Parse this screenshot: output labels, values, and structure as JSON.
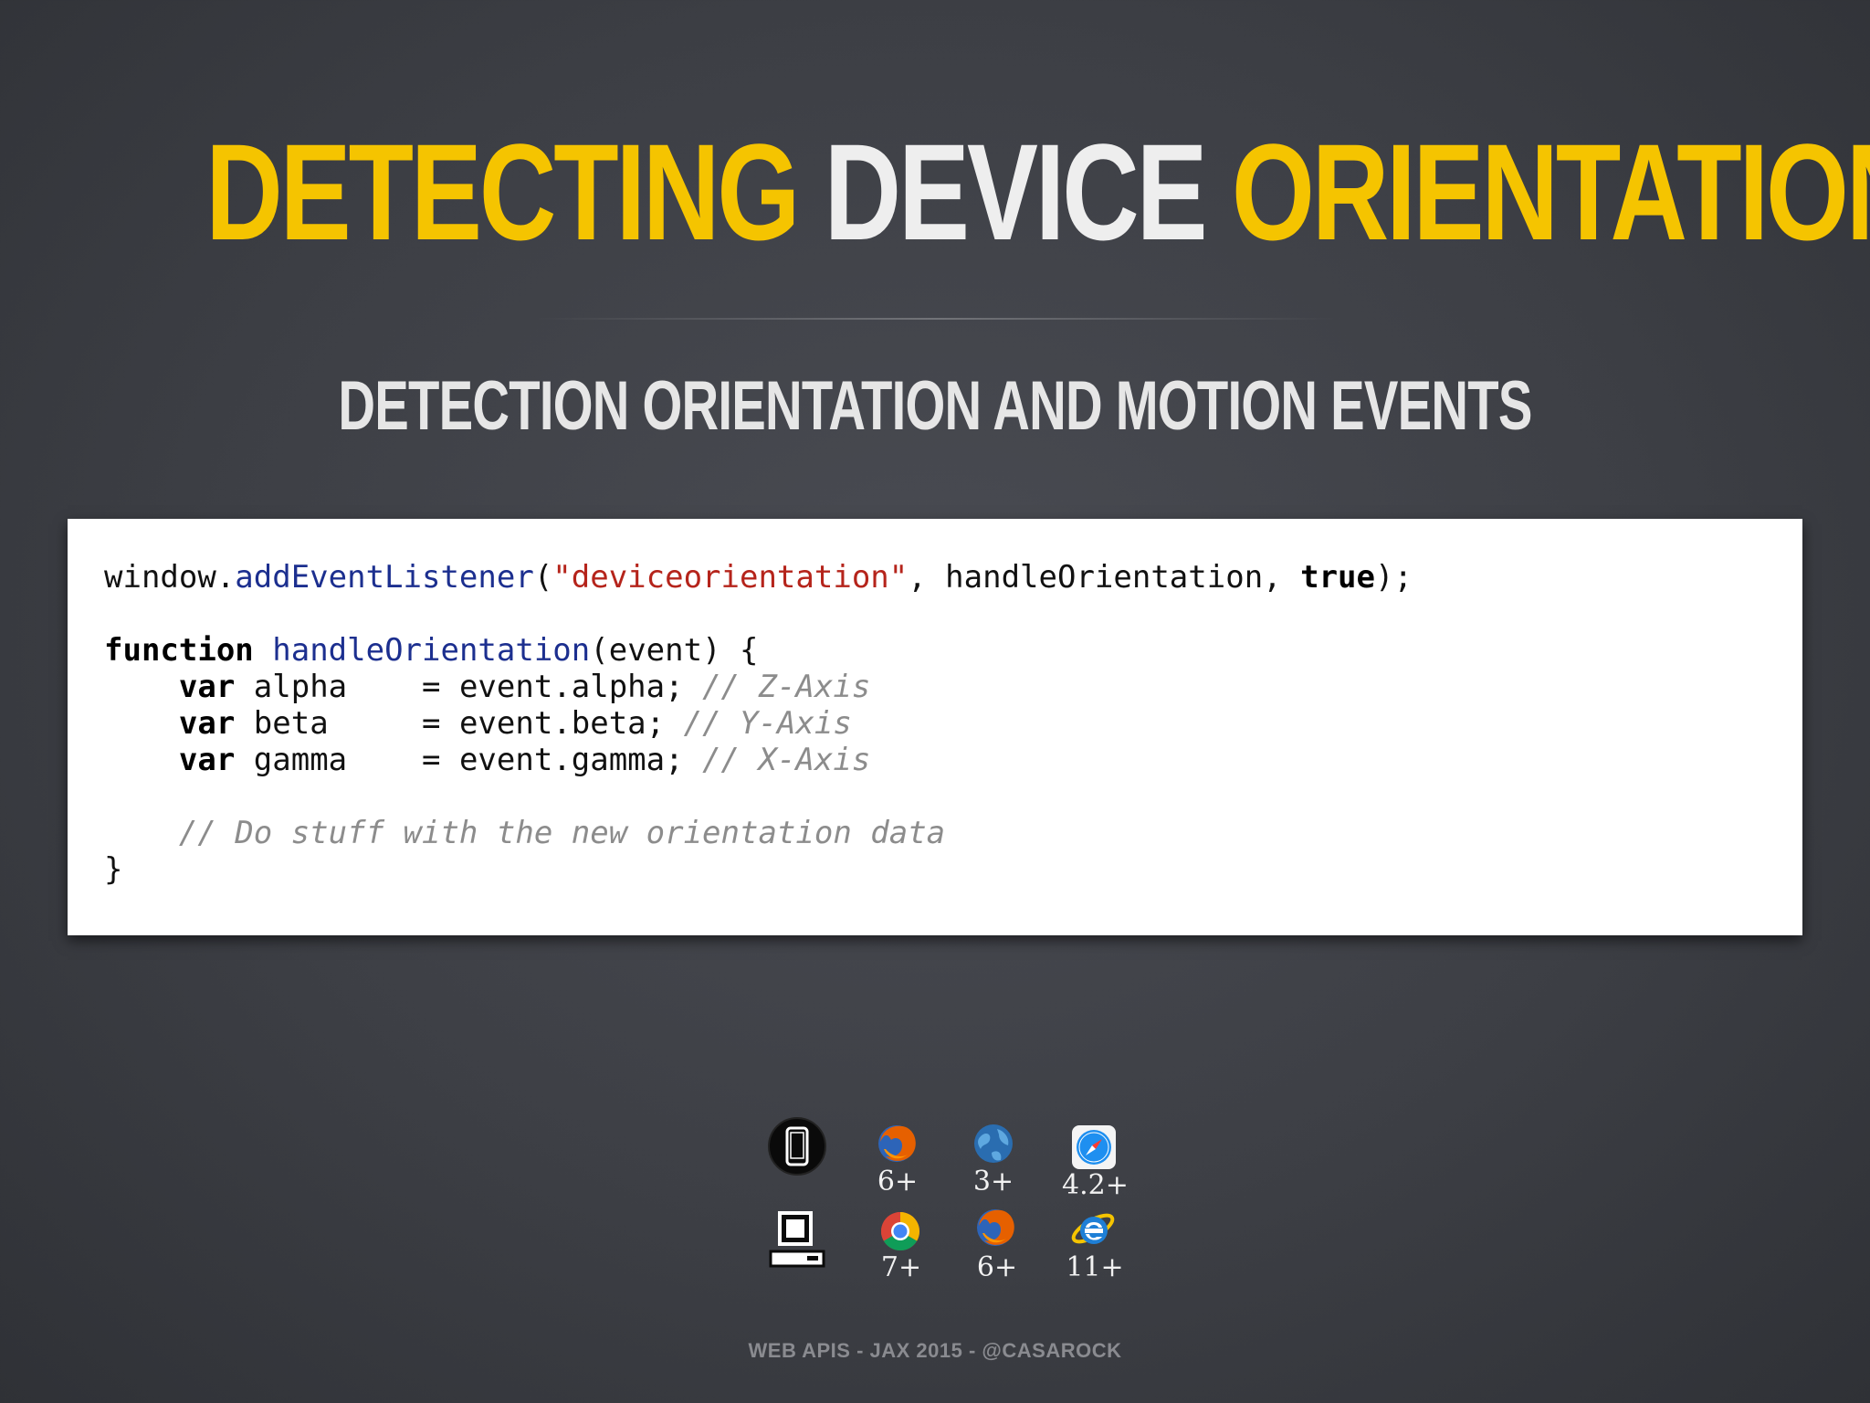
{
  "title": {
    "part1": "DETECTING",
    "part2": "DEVICE",
    "part3": "ORIENTATION"
  },
  "subtitle": "DETECTION ORIENTATION AND MOTION EVENTS",
  "code": {
    "line1": {
      "obj": "window.",
      "method": "addEventListener",
      "paren_open": "(",
      "event_name": "\"deviceorientation\"",
      "args": ", handleOrientation, ",
      "flag": "true",
      "end": ");"
    },
    "line2": {
      "keyword": "function",
      "name": "handleOrientation",
      "params": "(event) {"
    },
    "line3": {
      "keyword": "var",
      "rest": " alpha    = event.alpha; ",
      "comment": "// Z-Axis"
    },
    "line4": {
      "keyword": "var",
      "rest": " beta     = event.beta; ",
      "comment": "// Y-Axis"
    },
    "line5": {
      "keyword": "var",
      "rest": " gamma    = event.gamma; ",
      "comment": "// X-Axis"
    },
    "line6": {
      "comment": "// Do stuff with the new orientation data"
    },
    "line7": {
      "close": "}"
    }
  },
  "support": {
    "mobile": [
      {
        "icon": "firefox-icon",
        "version": "6+"
      },
      {
        "icon": "android-browser-icon",
        "version": "3+"
      },
      {
        "icon": "safari-icon",
        "version": "4.2+"
      }
    ],
    "desktop": [
      {
        "icon": "chrome-icon",
        "version": "7+"
      },
      {
        "icon": "firefox-icon",
        "version": "6+"
      },
      {
        "icon": "internet-explorer-icon",
        "version": "11+"
      }
    ]
  },
  "colors": {
    "accent": "#f5c400",
    "background": "#3d3f45"
  },
  "footer": "WEB APIS - JAX 2015 - @CASAROCK"
}
